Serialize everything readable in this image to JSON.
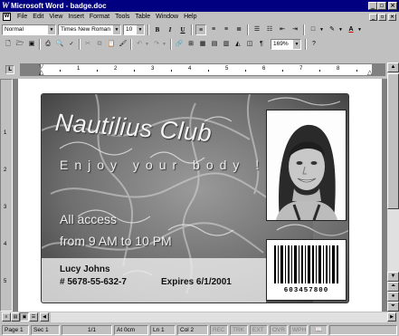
{
  "window": {
    "title": "Microsoft Word - badge.doc"
  },
  "menu": [
    "File",
    "Edit",
    "View",
    "Insert",
    "Format",
    "Tools",
    "Table",
    "Window",
    "Help"
  ],
  "format_toolbar": {
    "style": "Normal",
    "font": "Times New Roman",
    "size": "10",
    "bold": "B",
    "italic": "I",
    "underline": "U"
  },
  "standard_toolbar": {
    "zoom": "169%"
  },
  "ruler": {
    "labels": [
      "1",
      "2",
      "3",
      "4",
      "5",
      "6",
      "7",
      "8"
    ]
  },
  "vertical_ruler": {
    "labels": [
      "1",
      "2",
      "3",
      "4",
      "5"
    ]
  },
  "badge": {
    "title": "Nautilius Club",
    "tagline": "Enjoy your body !",
    "access": "All access",
    "hours": "from 9 AM to 10 PM",
    "name": "Lucy Johns",
    "member_number": "# 5678-55-632-7",
    "expires": "Expires 6/1/2001",
    "barcode_number": "603457800"
  },
  "status": {
    "page": "Page 1",
    "section": "Sec 1",
    "pages": "1/1",
    "at": "At 0cm",
    "line": "Ln 1",
    "col": "Col 2",
    "rec": "REC",
    "trk": "TRK",
    "ext": "EXT",
    "ovr": "OVR",
    "wph": "WPH"
  },
  "icons": {
    "window_controls": [
      "minimize-icon",
      "maximize-icon",
      "close-icon"
    ],
    "standard": [
      "new-icon",
      "open-icon",
      "save-icon",
      "print-icon",
      "print-preview-icon",
      "spelling-icon",
      "cut-icon",
      "copy-icon",
      "paste-icon",
      "format-painter-icon",
      "undo-icon",
      "redo-icon",
      "hyperlink-icon",
      "tables-borders-icon",
      "insert-table-icon",
      "insert-excel-icon",
      "columns-icon",
      "drawing-icon",
      "document-map-icon",
      "show-hide-icon",
      "help-icon"
    ]
  },
  "colors": {
    "titlebar": "#000080",
    "chrome": "#c0c0c0",
    "workspace": "#808080"
  }
}
